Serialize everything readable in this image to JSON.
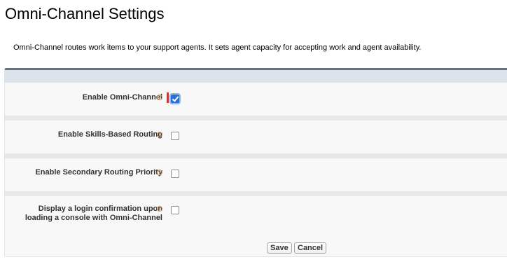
{
  "page": {
    "title": "Omni-Channel Settings",
    "description": "Omni-Channel routes work items to your support agents. It sets agent capacity for accepting work and agent availability."
  },
  "settings": [
    {
      "label": "Enable Omni-Channel",
      "checked": true,
      "required": true
    },
    {
      "label": "Enable Skills-Based Routing",
      "checked": false
    },
    {
      "label": "Enable Secondary Routing Priority",
      "checked": false
    },
    {
      "label_line1": "Display a login confirmation upon",
      "label_line2": "loading a console with Omni-Channel",
      "checked": false
    }
  ],
  "buttons": {
    "save": "Save",
    "cancel": "Cancel"
  },
  "icons": {
    "help": "help-icon",
    "checkbox": "checkbox-icon"
  },
  "colors": {
    "accent": "#2a6fd6",
    "required": "#c23934",
    "header_border": "#5f7182"
  }
}
